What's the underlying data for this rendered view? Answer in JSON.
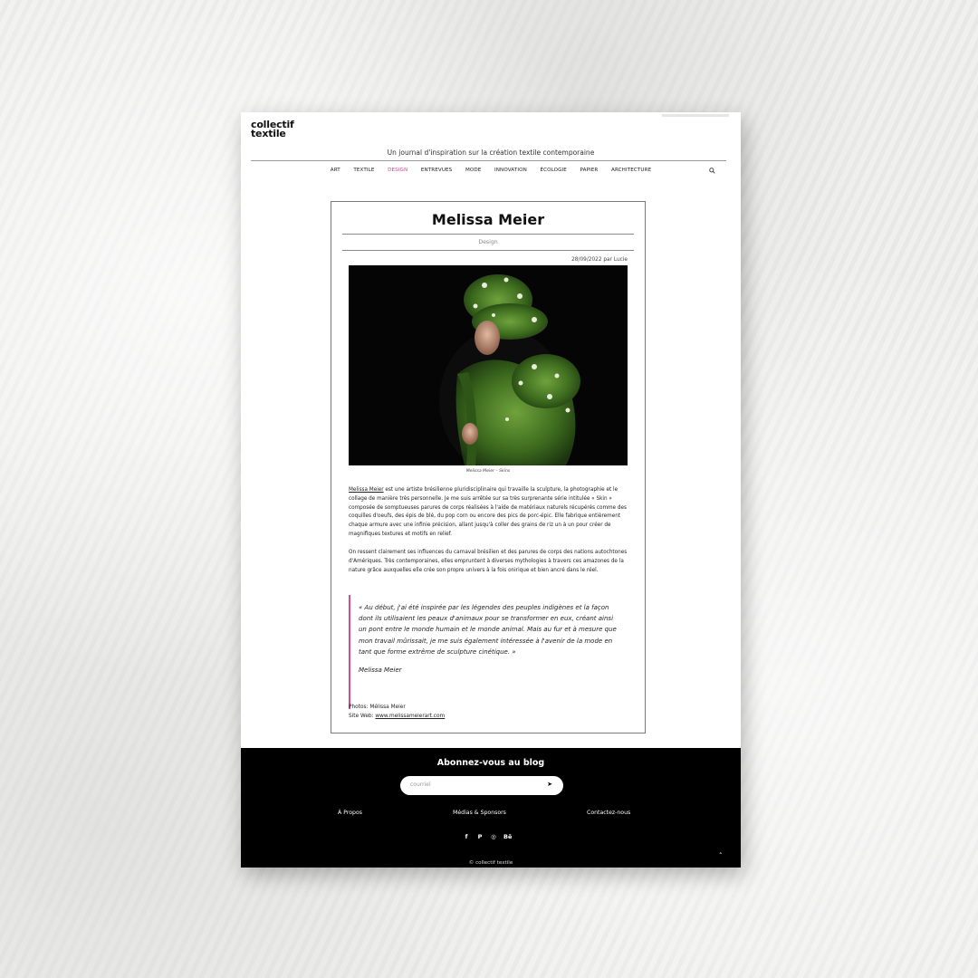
{
  "site": {
    "logo_line1": "collectif",
    "logo_line2": "textile",
    "tagline": "Un journal d'inspiration sur la création textile contemporaine"
  },
  "nav": {
    "items": [
      {
        "label": "ART",
        "active": false
      },
      {
        "label": "TEXTILE",
        "active": false
      },
      {
        "label": "DESIGN",
        "active": true
      },
      {
        "label": "ENTREVUES",
        "active": false
      },
      {
        "label": "MODE",
        "active": false
      },
      {
        "label": "INNOVATION",
        "active": false
      },
      {
        "label": "ÉCOLOGIE",
        "active": false
      },
      {
        "label": "PAPIER",
        "active": false
      },
      {
        "label": "ARCHITECTURE",
        "active": false
      }
    ],
    "search_icon": "search-icon",
    "accent_color": "#d44b8e"
  },
  "article": {
    "title": "Melissa Meier",
    "category": "Design",
    "dateline": "28/09/2022 par Lucie",
    "photo_caption": "Melissa Meier – Skins",
    "p1_link": "Melissa Meier",
    "p1_rest": " est une artiste brésilienne pluridisciplinaire qui travaille la sculpture, la photographie et le collage de manière très personnelle. Je me suis arrêtée sur sa très surprenante série intitulée « Skin » composée de somptueuses parures de corps réalisées à l'aide de matériaux naturels récupérés comme des coquilles d'oeufs, des épis de blé, du pop corn ou encore des pics de porc-épic. Elle fabrique entièrement chaque armure avec une infinie précision, allant jusqu'à coller des grains de riz un à un pour créer de magnifiques textures et motifs en relief.",
    "p2": "On ressent clairement ses influences du carnaval brésilien et des parures de corps des nations autochtones d'Amériques. Très contemporaines, elles empruntent à diverses mythologies à travers ces amazones de la nature grâce auxquelles elle crée son propre univers à la fois onirique et bien ancré dans le réel.",
    "quote": "« Au début, j'ai été inspirée par les légendes des peuples indigènes et la façon dont ils utilisaient les peaux d'animaux pour se transformer en eux, créant ainsi un pont entre le monde humain et le monde animal. Mais au fur et à mesure que mon travail mûrissait, je me suis également intéressée à l'avenir de la mode en tant que forme extrême de sculpture cinétique. »",
    "quote_author": "Melissa Meier",
    "credits_photos": "Photos: Mélissa Meier",
    "credits_site_label": "Site Web: ",
    "credits_site_url": "www.melissameierart.com"
  },
  "footer": {
    "subscribe_title": "Abonnez-vous au blog",
    "email_placeholder": "courriel",
    "send_symbol": "➤",
    "links": [
      "À Propos",
      "Médias & Sponsors",
      "Contactez-nous"
    ],
    "social": [
      {
        "icon": "facebook-icon",
        "glyph": "f"
      },
      {
        "icon": "pinterest-icon",
        "glyph": "P"
      },
      {
        "icon": "instagram-icon",
        "glyph": "◎"
      },
      {
        "icon": "behance-icon",
        "glyph": "Bē"
      }
    ],
    "copyright": "© collectif textile",
    "to_top_symbol": "˄"
  }
}
